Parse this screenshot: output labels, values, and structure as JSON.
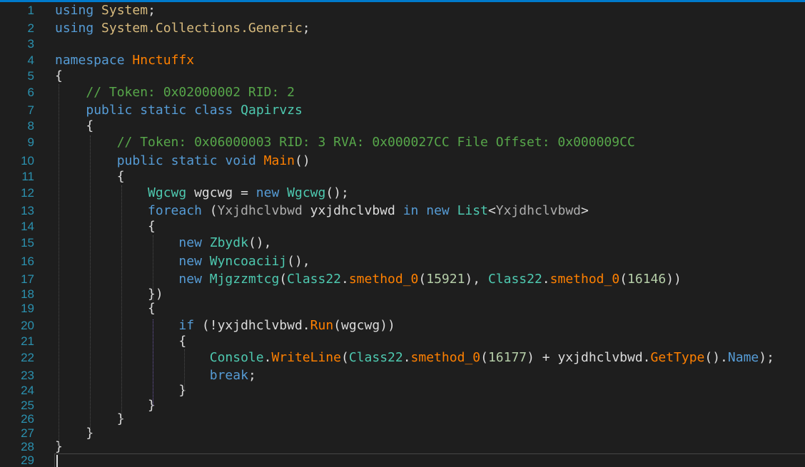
{
  "lines": [
    {
      "n": "1",
      "tokens": [
        [
          "using",
          "kw"
        ],
        [
          " ",
          "pl"
        ],
        [
          "System",
          "ns"
        ],
        [
          ";",
          "pu"
        ]
      ]
    },
    {
      "n": "2",
      "tokens": [
        [
          "using",
          "kw"
        ],
        [
          " ",
          "pl"
        ],
        [
          "System.Collections.Generic",
          "ns"
        ],
        [
          ";",
          "pu"
        ]
      ]
    },
    {
      "n": "3",
      "tokens": []
    },
    {
      "n": "4",
      "tokens": [
        [
          "namespace",
          "kw"
        ],
        [
          " ",
          "pl"
        ],
        [
          "Hnctuffx",
          "m"
        ]
      ]
    },
    {
      "n": "5",
      "tokens": [
        [
          "{",
          "pu"
        ]
      ]
    },
    {
      "n": "6",
      "tokens": [
        [
          "    ",
          "pl"
        ],
        [
          "// Token: 0x02000002 RID: 2",
          "cm"
        ]
      ]
    },
    {
      "n": "7",
      "tokens": [
        [
          "    ",
          "pl"
        ],
        [
          "public",
          "kw"
        ],
        [
          " ",
          "pl"
        ],
        [
          "static",
          "kw"
        ],
        [
          " ",
          "pl"
        ],
        [
          "class",
          "kw"
        ],
        [
          " ",
          "pl"
        ],
        [
          "Qapirvzs",
          "ty"
        ]
      ]
    },
    {
      "n": "8",
      "tokens": [
        [
          "    ",
          "pl"
        ],
        [
          "{",
          "pu"
        ]
      ]
    },
    {
      "n": "9",
      "tokens": [
        [
          "        ",
          "pl"
        ],
        [
          "// Token: 0x06000003 RID: 3 RVA: 0x000027CC File Offset: 0x000009CC",
          "cm"
        ]
      ]
    },
    {
      "n": "10",
      "tokens": [
        [
          "        ",
          "pl"
        ],
        [
          "public",
          "kw"
        ],
        [
          " ",
          "pl"
        ],
        [
          "static",
          "kw"
        ],
        [
          " ",
          "pl"
        ],
        [
          "void",
          "kw"
        ],
        [
          " ",
          "pl"
        ],
        [
          "Main",
          "m"
        ],
        [
          "()",
          "pu"
        ]
      ]
    },
    {
      "n": "11",
      "tokens": [
        [
          "        ",
          "pl"
        ],
        [
          "{",
          "pu"
        ]
      ]
    },
    {
      "n": "12",
      "tokens": [
        [
          "            ",
          "pl"
        ],
        [
          "Wgcwg",
          "ty"
        ],
        [
          " wgcwg = ",
          "pl"
        ],
        [
          "new",
          "kw"
        ],
        [
          " ",
          "pl"
        ],
        [
          "Wgcwg",
          "ty"
        ],
        [
          "();",
          "pu"
        ]
      ]
    },
    {
      "n": "13",
      "tokens": [
        [
          "            ",
          "pl"
        ],
        [
          "foreach",
          "kw"
        ],
        [
          " (",
          "pu"
        ],
        [
          "Yxjdhclvbwd",
          "tn"
        ],
        [
          " yxjdhclvbwd ",
          "pl"
        ],
        [
          "in",
          "kw"
        ],
        [
          " ",
          "pl"
        ],
        [
          "new",
          "kw"
        ],
        [
          " ",
          "pl"
        ],
        [
          "List",
          "ty"
        ],
        [
          "<",
          "pu"
        ],
        [
          "Yxjdhclvbwd",
          "tn"
        ],
        [
          ">",
          "pu"
        ]
      ]
    },
    {
      "n": "14",
      "tokens": [
        [
          "            ",
          "pl"
        ],
        [
          "{",
          "pu"
        ]
      ]
    },
    {
      "n": "15",
      "tokens": [
        [
          "                ",
          "pl"
        ],
        [
          "new",
          "kw"
        ],
        [
          " ",
          "pl"
        ],
        [
          "Zbydk",
          "ty"
        ],
        [
          "(),",
          "pu"
        ]
      ]
    },
    {
      "n": "16",
      "tokens": [
        [
          "                ",
          "pl"
        ],
        [
          "new",
          "kw"
        ],
        [
          " ",
          "pl"
        ],
        [
          "Wyncoaciij",
          "ty"
        ],
        [
          "(),",
          "pu"
        ]
      ]
    },
    {
      "n": "17",
      "tokens": [
        [
          "                ",
          "pl"
        ],
        [
          "new",
          "kw"
        ],
        [
          " ",
          "pl"
        ],
        [
          "Mjgzzmtcg",
          "ty"
        ],
        [
          "(",
          "pu"
        ],
        [
          "Class22",
          "ty"
        ],
        [
          ".",
          "pu"
        ],
        [
          "smethod_0",
          "m"
        ],
        [
          "(",
          "pu"
        ],
        [
          "15921",
          "nu"
        ],
        [
          "), ",
          "pu"
        ],
        [
          "Class22",
          "ty"
        ],
        [
          ".",
          "pu"
        ],
        [
          "smethod_0",
          "m"
        ],
        [
          "(",
          "pu"
        ],
        [
          "16146",
          "nu"
        ],
        [
          "))",
          "pu"
        ]
      ]
    },
    {
      "n": "18",
      "tokens": [
        [
          "            ",
          "pl"
        ],
        [
          "})",
          "pu"
        ]
      ]
    },
    {
      "n": "19",
      "tokens": [
        [
          "            ",
          "pl"
        ],
        [
          "{",
          "pu"
        ]
      ]
    },
    {
      "n": "20",
      "tokens": [
        [
          "                ",
          "pl"
        ],
        [
          "if",
          "kw"
        ],
        [
          " (!yxjdhclvbwd.",
          "pl"
        ],
        [
          "Run",
          "m"
        ],
        [
          "(wgcwg))",
          "pu"
        ]
      ]
    },
    {
      "n": "21",
      "tokens": [
        [
          "                ",
          "pl"
        ],
        [
          "{",
          "pu"
        ]
      ]
    },
    {
      "n": "22",
      "tokens": [
        [
          "                    ",
          "pl"
        ],
        [
          "Console",
          "ty"
        ],
        [
          ".",
          "pu"
        ],
        [
          "WriteLine",
          "m"
        ],
        [
          "(",
          "pu"
        ],
        [
          "Class22",
          "ty"
        ],
        [
          ".",
          "pu"
        ],
        [
          "smethod_0",
          "m"
        ],
        [
          "(",
          "pu"
        ],
        [
          "16177",
          "nu"
        ],
        [
          ") + yxjdhclvbwd.",
          "pl"
        ],
        [
          "GetType",
          "m"
        ],
        [
          "().",
          "pu"
        ],
        [
          "Name",
          "pr"
        ],
        [
          ");",
          "pu"
        ]
      ]
    },
    {
      "n": "23",
      "tokens": [
        [
          "                    ",
          "pl"
        ],
        [
          "break",
          "kw"
        ],
        [
          ";",
          "pu"
        ]
      ]
    },
    {
      "n": "24",
      "tokens": [
        [
          "                ",
          "pl"
        ],
        [
          "}",
          "pu"
        ]
      ]
    },
    {
      "n": "25",
      "tokens": [
        [
          "            ",
          "pl"
        ],
        [
          "}",
          "pu"
        ]
      ]
    },
    {
      "n": "26",
      "tokens": [
        [
          "        ",
          "pl"
        ],
        [
          "}",
          "pu"
        ]
      ]
    },
    {
      "n": "27",
      "tokens": [
        [
          "    ",
          "pl"
        ],
        [
          "}",
          "pu"
        ]
      ]
    },
    {
      "n": "28",
      "tokens": [
        [
          "}",
          "pu"
        ]
      ]
    },
    {
      "n": "29",
      "tokens": []
    }
  ],
  "colors": {
    "background": "#1e1e1e",
    "line_number": "#2b91af",
    "keyword": "#569cd6",
    "type": "#4ec9b0",
    "method": "#ff8000",
    "number": "#b5cea8",
    "comment": "#57a64a",
    "accent": "#007acc"
  }
}
